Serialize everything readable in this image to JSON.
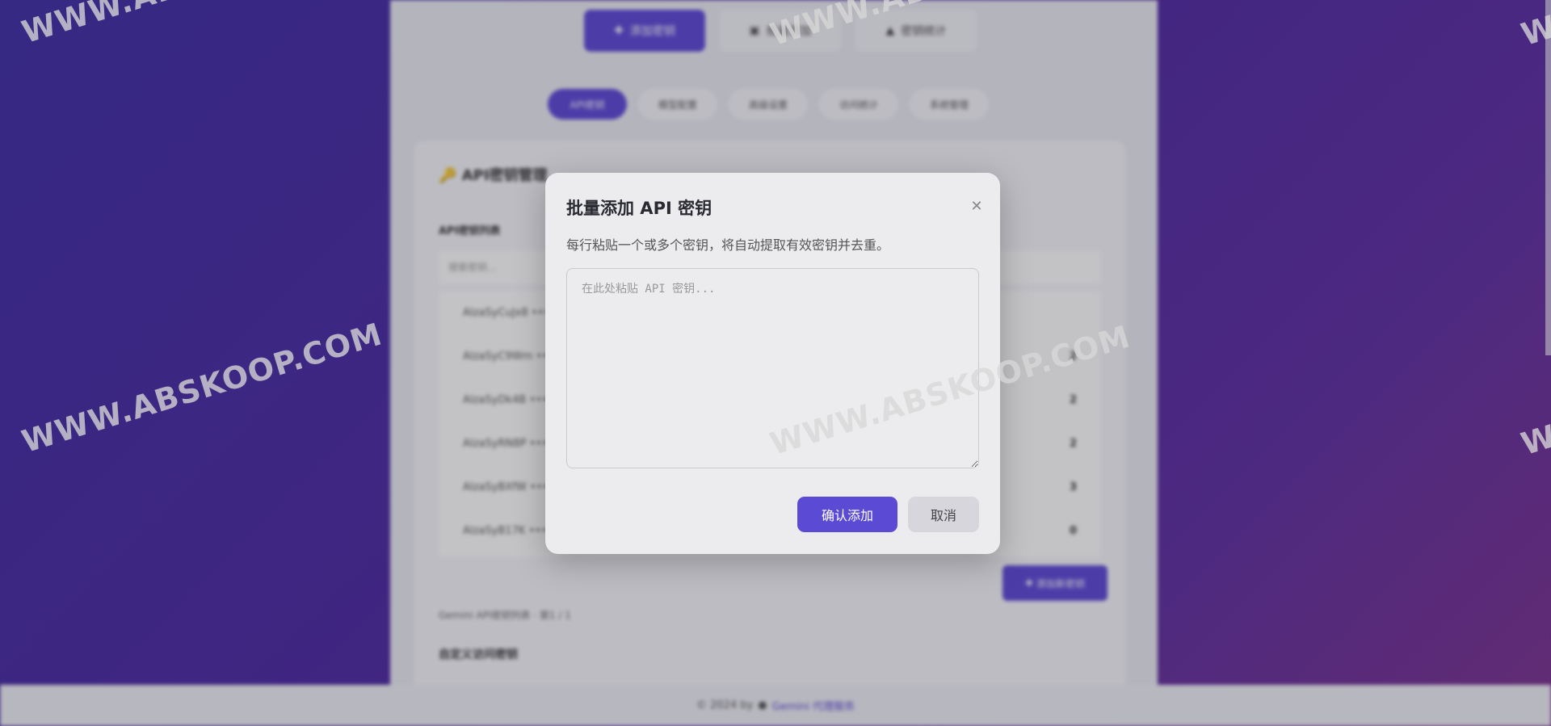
{
  "background": {
    "top_tabs": [
      {
        "label": "添加密钥",
        "icon": "plus-icon",
        "active": true
      },
      {
        "label": "批量添加",
        "icon": "stack-icon",
        "active": false
      },
      {
        "label": "密钥统计",
        "icon": "warning-icon",
        "active": false
      }
    ],
    "sub_tabs": [
      {
        "label": "API密钥",
        "active": true
      },
      {
        "label": "模型配置",
        "active": false
      },
      {
        "label": "高级设置",
        "active": false
      },
      {
        "label": "访问统计",
        "active": false
      },
      {
        "label": "系统管理",
        "active": false
      }
    ],
    "card": {
      "title": "API密钥管理",
      "list_label": "API密钥列表",
      "search_placeholder": "搜索密钥...",
      "rows": [
        {
          "key": "AIzaSyCuJx8 •••••••••••••••••••• t1Gk8hwRx",
          "count": ""
        },
        {
          "key": "AIzaSyC9Wm •••••••••••••••••••• nDcQyF8ia",
          "count": "2"
        },
        {
          "key": "AIzaSyDk4B •••••••••••••••••••• 7TqLs9dRx",
          "count": "2"
        },
        {
          "key": "AIzaSyRN8P •••••••••••••••••••• MqZsWjGuh",
          "count": "2"
        },
        {
          "key": "AIzaSyBXfW •••••••••••••••••••• Vx2PpL3Cm",
          "count": "3"
        },
        {
          "key": "AIzaSyB17K •••••••••••••••••••• hQwNe8Tf5",
          "count": "0"
        }
      ],
      "add_button": "添加新密钥",
      "info": "Gemini API密钥列表 · 第1 / 1",
      "sub_title": "自定义访问密钥"
    },
    "footer": {
      "text": "© 2024 by",
      "brand": "Gemini 代理服务"
    }
  },
  "watermark": {
    "text": "WWW.ABSKOOP.COM"
  },
  "modal": {
    "title": "批量添加 API 密钥",
    "description": "每行粘贴一个或多个密钥，将自动提取有效密钥并去重。",
    "textarea_placeholder": "在此处粘贴 API 密钥...",
    "textarea_value": "",
    "confirm_label": "确认添加",
    "cancel_label": "取消",
    "close_icon": "close-icon"
  },
  "colors": {
    "accent": "#5b4bd4",
    "bg_gradient_start": "#3b2aa3",
    "bg_gradient_end": "#7a2e8c",
    "modal_bg": "#ececef",
    "cancel_bg": "#d6d6dc"
  }
}
